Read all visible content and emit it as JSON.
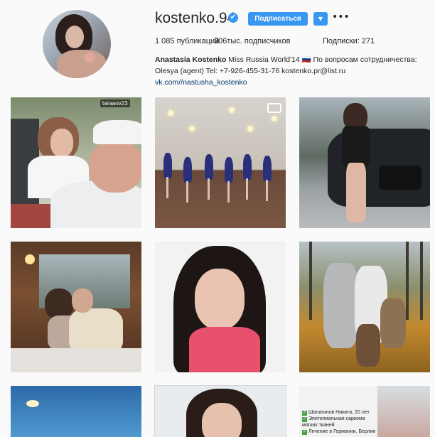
{
  "profile": {
    "username": "kostenko.94",
    "follow_label": "Подписаться",
    "verified_icon": "✔",
    "dropdown_icon": "▼",
    "more_icon": "•••",
    "posts": "1 085 публикаций",
    "followers": "306тыс. подписчиков",
    "following": "Подписки: 271",
    "bio_name": "Anastasia Kostenko",
    "bio_text": "Miss Russia World'14 🇷🇺 По вопросам сотрудничества: Olesya (agent) Tel: +7-926-455-31-76 kostenko.pr@list.ru",
    "bio_link": "vk.com//nastusha_kostenko"
  },
  "posts": {
    "tile1_tag": "taraaov23",
    "tile9_lines": [
      "Шалагинов Никита, 20 лет",
      "Эпителиальная саркома",
      "мягких тканей",
      "Лечение в Германии, Берлин"
    ]
  },
  "colors": {
    "accent": "#3897f0",
    "background": "#fafafa",
    "link": "#003569"
  }
}
